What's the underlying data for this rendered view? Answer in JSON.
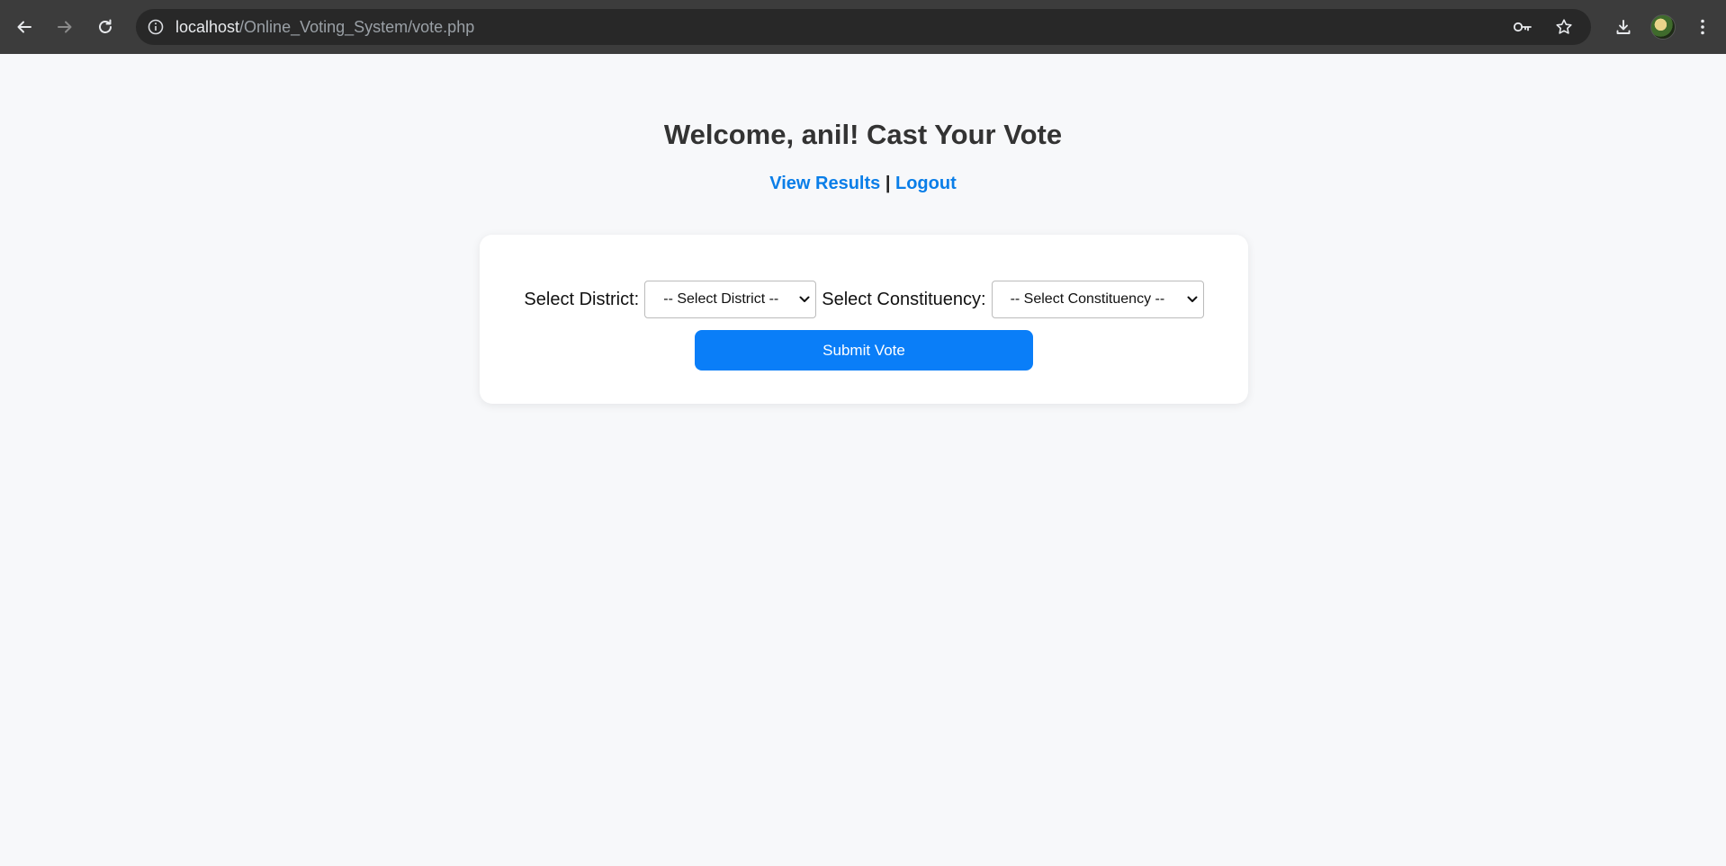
{
  "browser": {
    "url_host": "localhost",
    "url_path": "/Online_Voting_System/vote.php"
  },
  "page": {
    "title": "Welcome, anil! Cast Your Vote",
    "links": {
      "results": "View Results",
      "separator": "|",
      "logout": "Logout"
    }
  },
  "form": {
    "district_label": "Select District:",
    "district_selected": "-- Select District --",
    "constituency_label": "Select Constituency:",
    "constituency_selected": "-- Select Constituency --",
    "submit_label": "Submit Vote"
  },
  "colors": {
    "accent": "#0a7ef8",
    "link": "#0a7ee8",
    "background": "#f7f8fa",
    "heading": "#333333"
  },
  "icons": {
    "back": "arrow-left-icon",
    "forward": "arrow-right-icon",
    "reload": "reload-icon",
    "site_info": "info-icon",
    "passwords": "key-icon",
    "bookmark": "star-icon",
    "download": "download-icon",
    "menu": "kebab-menu-icon",
    "dropdown": "chevron-down-icon"
  }
}
